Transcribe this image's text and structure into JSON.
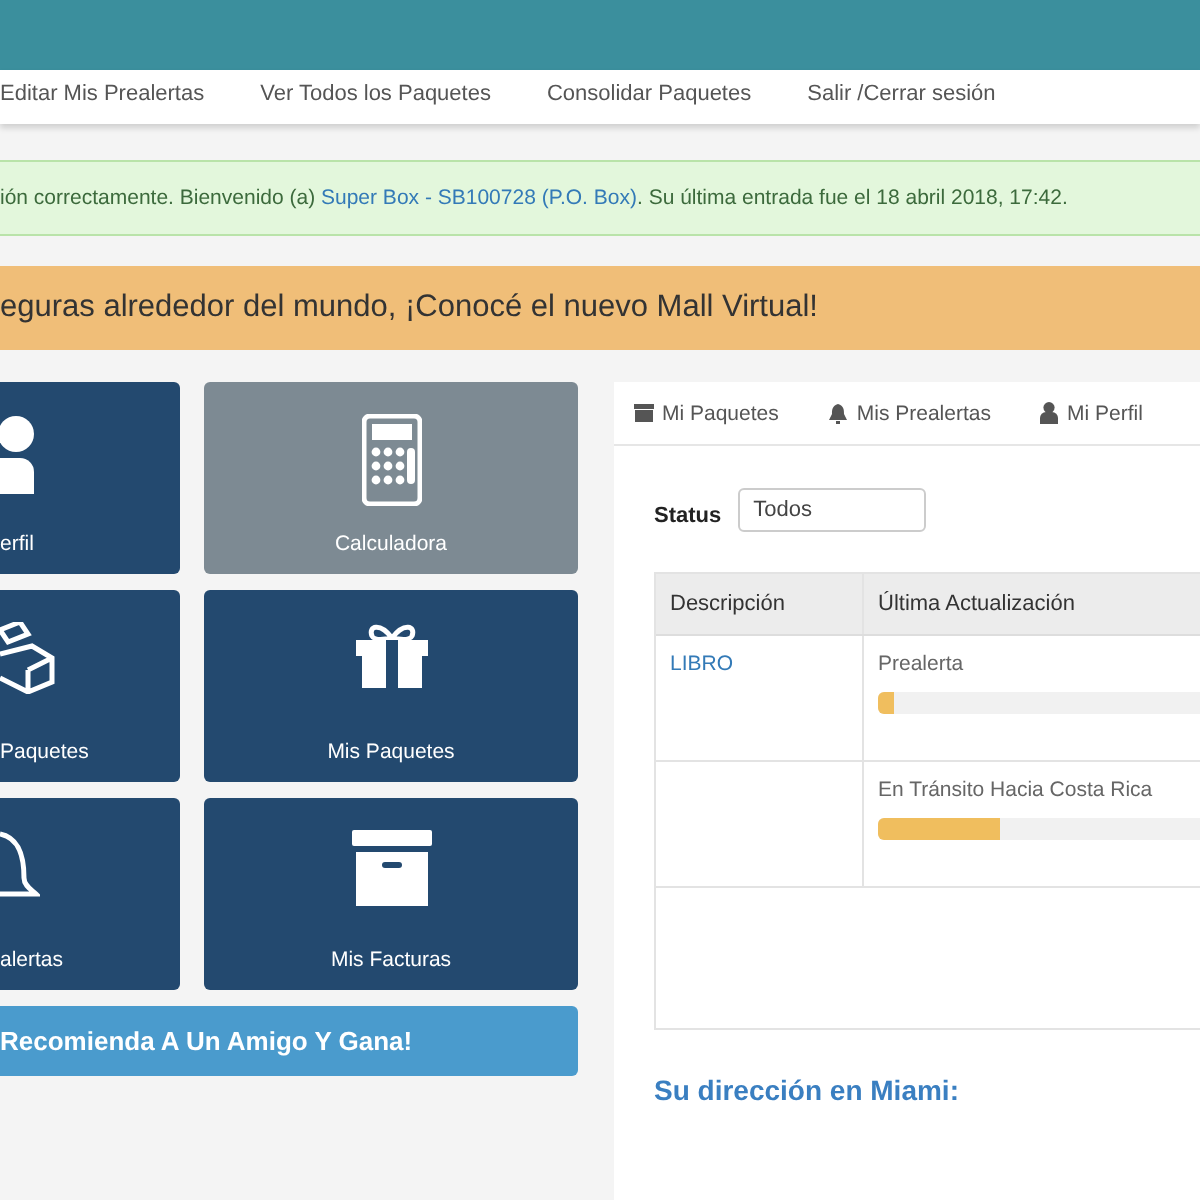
{
  "nav": {
    "items": [
      "Editar Mis Prealertas",
      "Ver Todos los Paquetes",
      "Consolidar Paquetes",
      "Salir /Cerrar sesión"
    ]
  },
  "alert": {
    "text_before": "ión correctamente. Bienvenido (a) ",
    "link": "Super Box - SB100728 (P.O. Box)",
    "text_after": ". Su última entrada fue el 18 abril 2018, 17:42."
  },
  "banner": {
    "text": "eguras alrededor del mundo, ¡Conocé el nuevo Mall Virtual!"
  },
  "tiles": [
    {
      "label": "erfil",
      "kind": "person",
      "disabled": false
    },
    {
      "label": "Calculadora",
      "kind": "calculator",
      "disabled": true
    },
    {
      "label": "Paquetes",
      "kind": "boxes",
      "disabled": false
    },
    {
      "label": "Mis Paquetes",
      "kind": "gift",
      "disabled": false
    },
    {
      "label": "alertas",
      "kind": "bell",
      "disabled": false
    },
    {
      "label": "Mis Facturas",
      "kind": "archive",
      "disabled": false
    }
  ],
  "promo_button": "Recomienda A Un Amigo Y Gana!",
  "tabs": [
    {
      "label": "Mi Paquetes",
      "kind": "archive",
      "selected": false
    },
    {
      "label": "Mis Prealertas",
      "kind": "bell",
      "selected": false
    },
    {
      "label": "Mi Perfil",
      "kind": "person",
      "selected": false
    }
  ],
  "status_filter": {
    "label": "Status",
    "value": "Todos"
  },
  "table": {
    "columns": [
      "Descripción",
      "Última Actualización"
    ],
    "rows": [
      {
        "description": "LIBRO",
        "status": "Prealerta",
        "level": 0.05
      },
      {
        "description": "",
        "status": "En Tránsito Hacia Costa Rica",
        "level": 0.38
      }
    ]
  },
  "address_heading": "Su dirección en Miami:"
}
